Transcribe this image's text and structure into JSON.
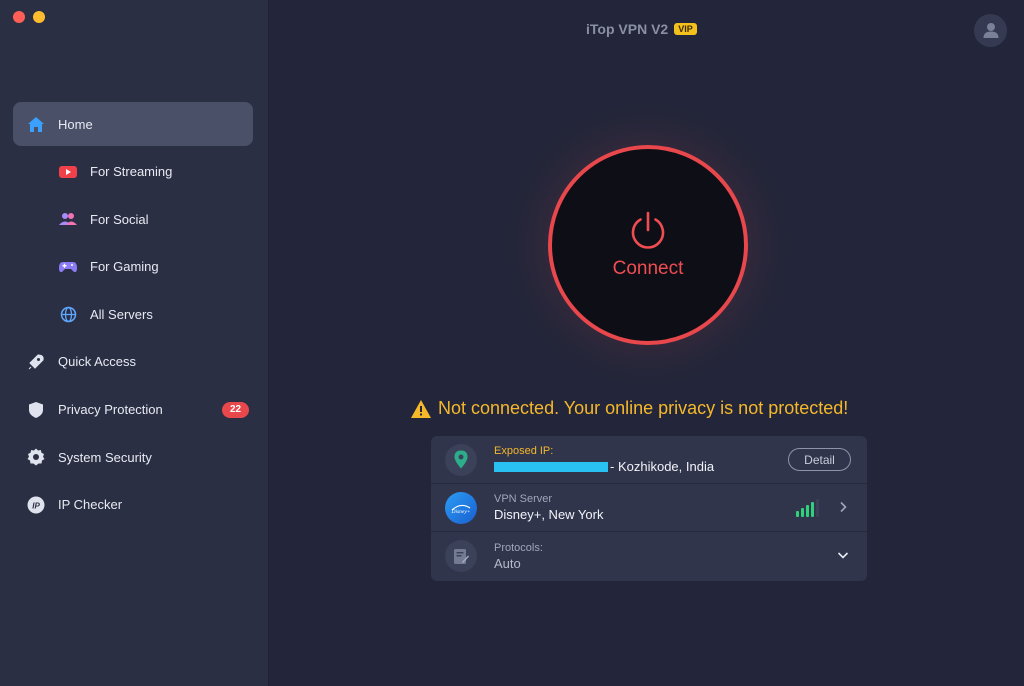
{
  "window": {
    "title": "iTop VPN V2",
    "vip_badge": "VIP"
  },
  "sidebar": {
    "items": [
      {
        "label": "Home",
        "icon": "home-icon",
        "active": true
      },
      {
        "label": "For Streaming",
        "icon": "youtube-play-icon"
      },
      {
        "label": "For Social",
        "icon": "people-icon"
      },
      {
        "label": "For Gaming",
        "icon": "gamepad-icon"
      },
      {
        "label": "All Servers",
        "icon": "globe-icon"
      },
      {
        "label": "Quick Access",
        "icon": "rocket-icon"
      },
      {
        "label": "Privacy Protection",
        "icon": "shield-icon",
        "badge": "22"
      },
      {
        "label": "System Security",
        "icon": "gear-icon"
      },
      {
        "label": "IP Checker",
        "icon": "ip-icon"
      }
    ]
  },
  "connect": {
    "label": "Connect",
    "status_text": "Not connected. Your online privacy is not protected!"
  },
  "info": {
    "exposed_ip_label": "Exposed IP:",
    "exposed_ip_location": "- Kozhikode, India",
    "detail_button": "Detail",
    "vpn_server_label": "VPN Server",
    "vpn_server_value": "Disney+, New York",
    "protocols_label": "Protocols:",
    "protocols_value": "Auto"
  },
  "colors": {
    "accent_red": "#e8474c",
    "warning": "#f5b82a",
    "signal_green": "#2fd17b",
    "background": "#23263a",
    "sidebar": "#2b2f44"
  }
}
